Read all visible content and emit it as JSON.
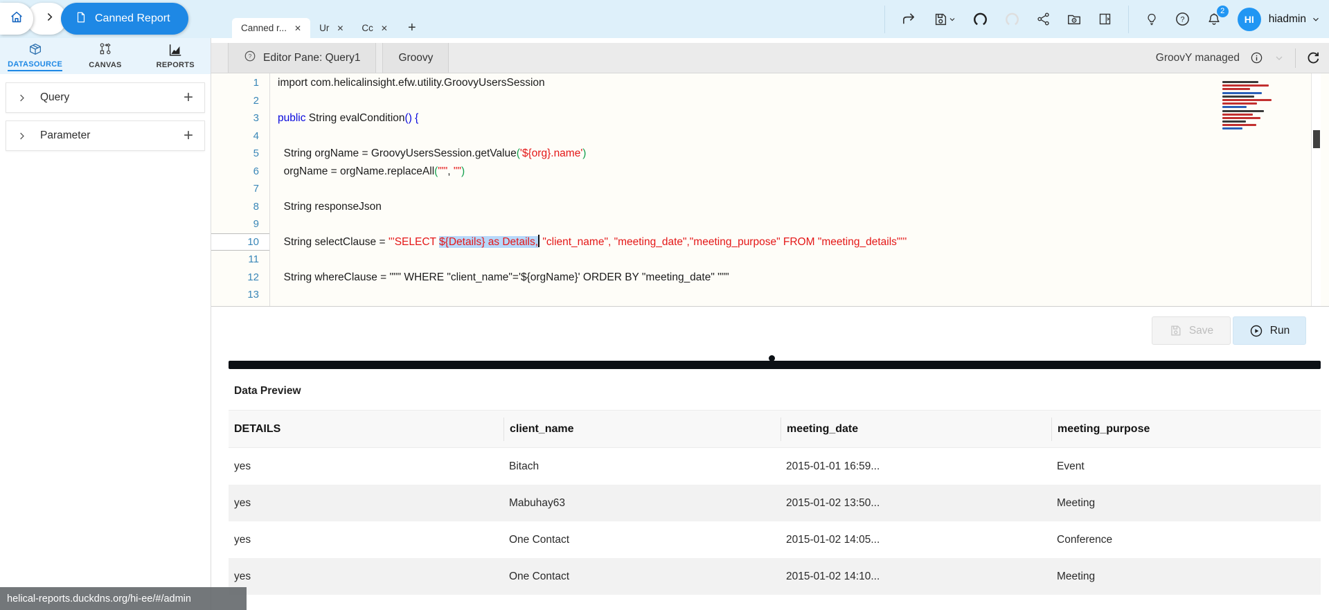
{
  "topbar": {
    "breadcrumb_title": "Canned Report",
    "tabs": [
      {
        "label": "Canned r...",
        "active": true
      },
      {
        "label": "Ur",
        "active": false
      },
      {
        "label": "Cc",
        "active": false
      }
    ],
    "toolbar_icons": [
      "forward-icon",
      "save-icon",
      "undo-icon",
      "redo-icon",
      "share-icon",
      "folder-settings-icon",
      "panel-icon",
      "lightbulb-icon",
      "help-icon",
      "bell-icon"
    ],
    "user": {
      "initials": "HI",
      "name": "hiadmin",
      "notification_count": "2"
    }
  },
  "sidebar": {
    "tabs": [
      {
        "label": "DATASOURCE",
        "active": true
      },
      {
        "label": "CANVAS",
        "active": false
      },
      {
        "label": "REPORTS",
        "active": false
      }
    ],
    "sections": [
      {
        "label": "Query"
      },
      {
        "label": "Parameter"
      }
    ]
  },
  "editor": {
    "pane_tab": "Editor Pane: Query1",
    "lang_tab": "Groovy",
    "mode_label": "GroovY managed",
    "save_label": "Save",
    "run_label": "Run",
    "lines": [
      {
        "n": "1",
        "seg": [
          {
            "t": "import com.helicalinsight.efw.utility.GroovyUsersSession",
            "c": "plain"
          }
        ]
      },
      {
        "n": "2",
        "seg": []
      },
      {
        "n": "3",
        "seg": [
          {
            "t": "public",
            "c": "kw"
          },
          {
            "t": " String evalCondition",
            "c": "plain"
          },
          {
            "t": "() {",
            "c": "kw"
          }
        ]
      },
      {
        "n": "4",
        "seg": []
      },
      {
        "n": "5",
        "seg": [
          {
            "t": "  String orgName = GroovyUsersSession.getValue",
            "c": "plain"
          },
          {
            "t": "(",
            "c": "br"
          },
          {
            "t": "'${org}.name'",
            "c": "str"
          },
          {
            "t": ")",
            "c": "br"
          }
        ]
      },
      {
        "n": "6",
        "seg": [
          {
            "t": "  orgName = orgName.replaceAll",
            "c": "plain"
          },
          {
            "t": "(",
            "c": "br"
          },
          {
            "t": "\"'\"",
            "c": "str"
          },
          {
            "t": ", ",
            "c": "plain"
          },
          {
            "t": "\"\"",
            "c": "str"
          },
          {
            "t": ")",
            "c": "br"
          }
        ]
      },
      {
        "n": "7",
        "seg": []
      },
      {
        "n": "8",
        "seg": [
          {
            "t": "  String responseJson",
            "c": "plain"
          }
        ]
      },
      {
        "n": "9",
        "seg": []
      },
      {
        "n": "10",
        "active": true,
        "seg": [
          {
            "t": "  String selectClause = ",
            "c": "plain"
          },
          {
            "t": "'''SELECT ",
            "c": "str"
          },
          {
            "t": "${Details} as Details,",
            "c": "str sel"
          },
          {
            "cursor": true
          },
          {
            "t": " \"client_name\", \"meeting_date\",\"meeting_purpose\" FROM \"meeting_details\"'''",
            "c": "str"
          }
        ]
      },
      {
        "n": "11",
        "seg": []
      },
      {
        "n": "12",
        "seg": [
          {
            "t": "  String whereClause = \"\"\" WHERE \"client_name\"='${orgName}' ORDER BY \"meeting_date\" \"\"\"",
            "c": "plain"
          }
        ]
      },
      {
        "n": "13",
        "seg": []
      }
    ],
    "minimap": [
      [
        "#3a3a3a",
        62
      ],
      [
        "#c23030",
        80
      ],
      [
        "#c23030",
        48
      ],
      [
        "#2a5fb8",
        68
      ],
      [
        "#3a3a3a",
        55
      ],
      [
        "#c23030",
        85
      ],
      [
        "#c23030",
        60
      ],
      [
        "#2a5fb8",
        42
      ],
      [
        "#3a3a3a",
        72
      ],
      [
        "#c23030",
        52
      ],
      [
        "#c23030",
        66
      ],
      [
        "#3a3a3a",
        40
      ],
      [
        "#c23030",
        58
      ],
      [
        "#2a5fb8",
        35
      ]
    ]
  },
  "preview": {
    "title": "Data Preview",
    "columns": [
      "DETAILS",
      "client_name",
      "meeting_date",
      "meeting_purpose"
    ],
    "rows": [
      [
        "yes",
        "Bitach",
        "2015-01-01 16:59...",
        "Event"
      ],
      [
        "yes",
        "Mabuhay63",
        "2015-01-02 13:50...",
        "Meeting"
      ],
      [
        "yes",
        "One Contact",
        "2015-01-02 14:05...",
        "Conference"
      ],
      [
        "yes",
        "One Contact",
        "2015-01-02 14:10...",
        "Meeting"
      ]
    ]
  },
  "statusbar": {
    "url": "helical-reports.duckdns.org/hi-ee/#/admin"
  },
  "colors": {
    "accent": "#1e88e5",
    "topbar_bg": "#def0fa",
    "keyword": "#0808dd",
    "string": "#e41717",
    "bracket": "#14a04e",
    "selection": "#b7d8fa",
    "line_number": "#3a87b8",
    "run_button_bg": "#dbedf9",
    "badge": "#2196f3",
    "divider": "#0c1015"
  }
}
